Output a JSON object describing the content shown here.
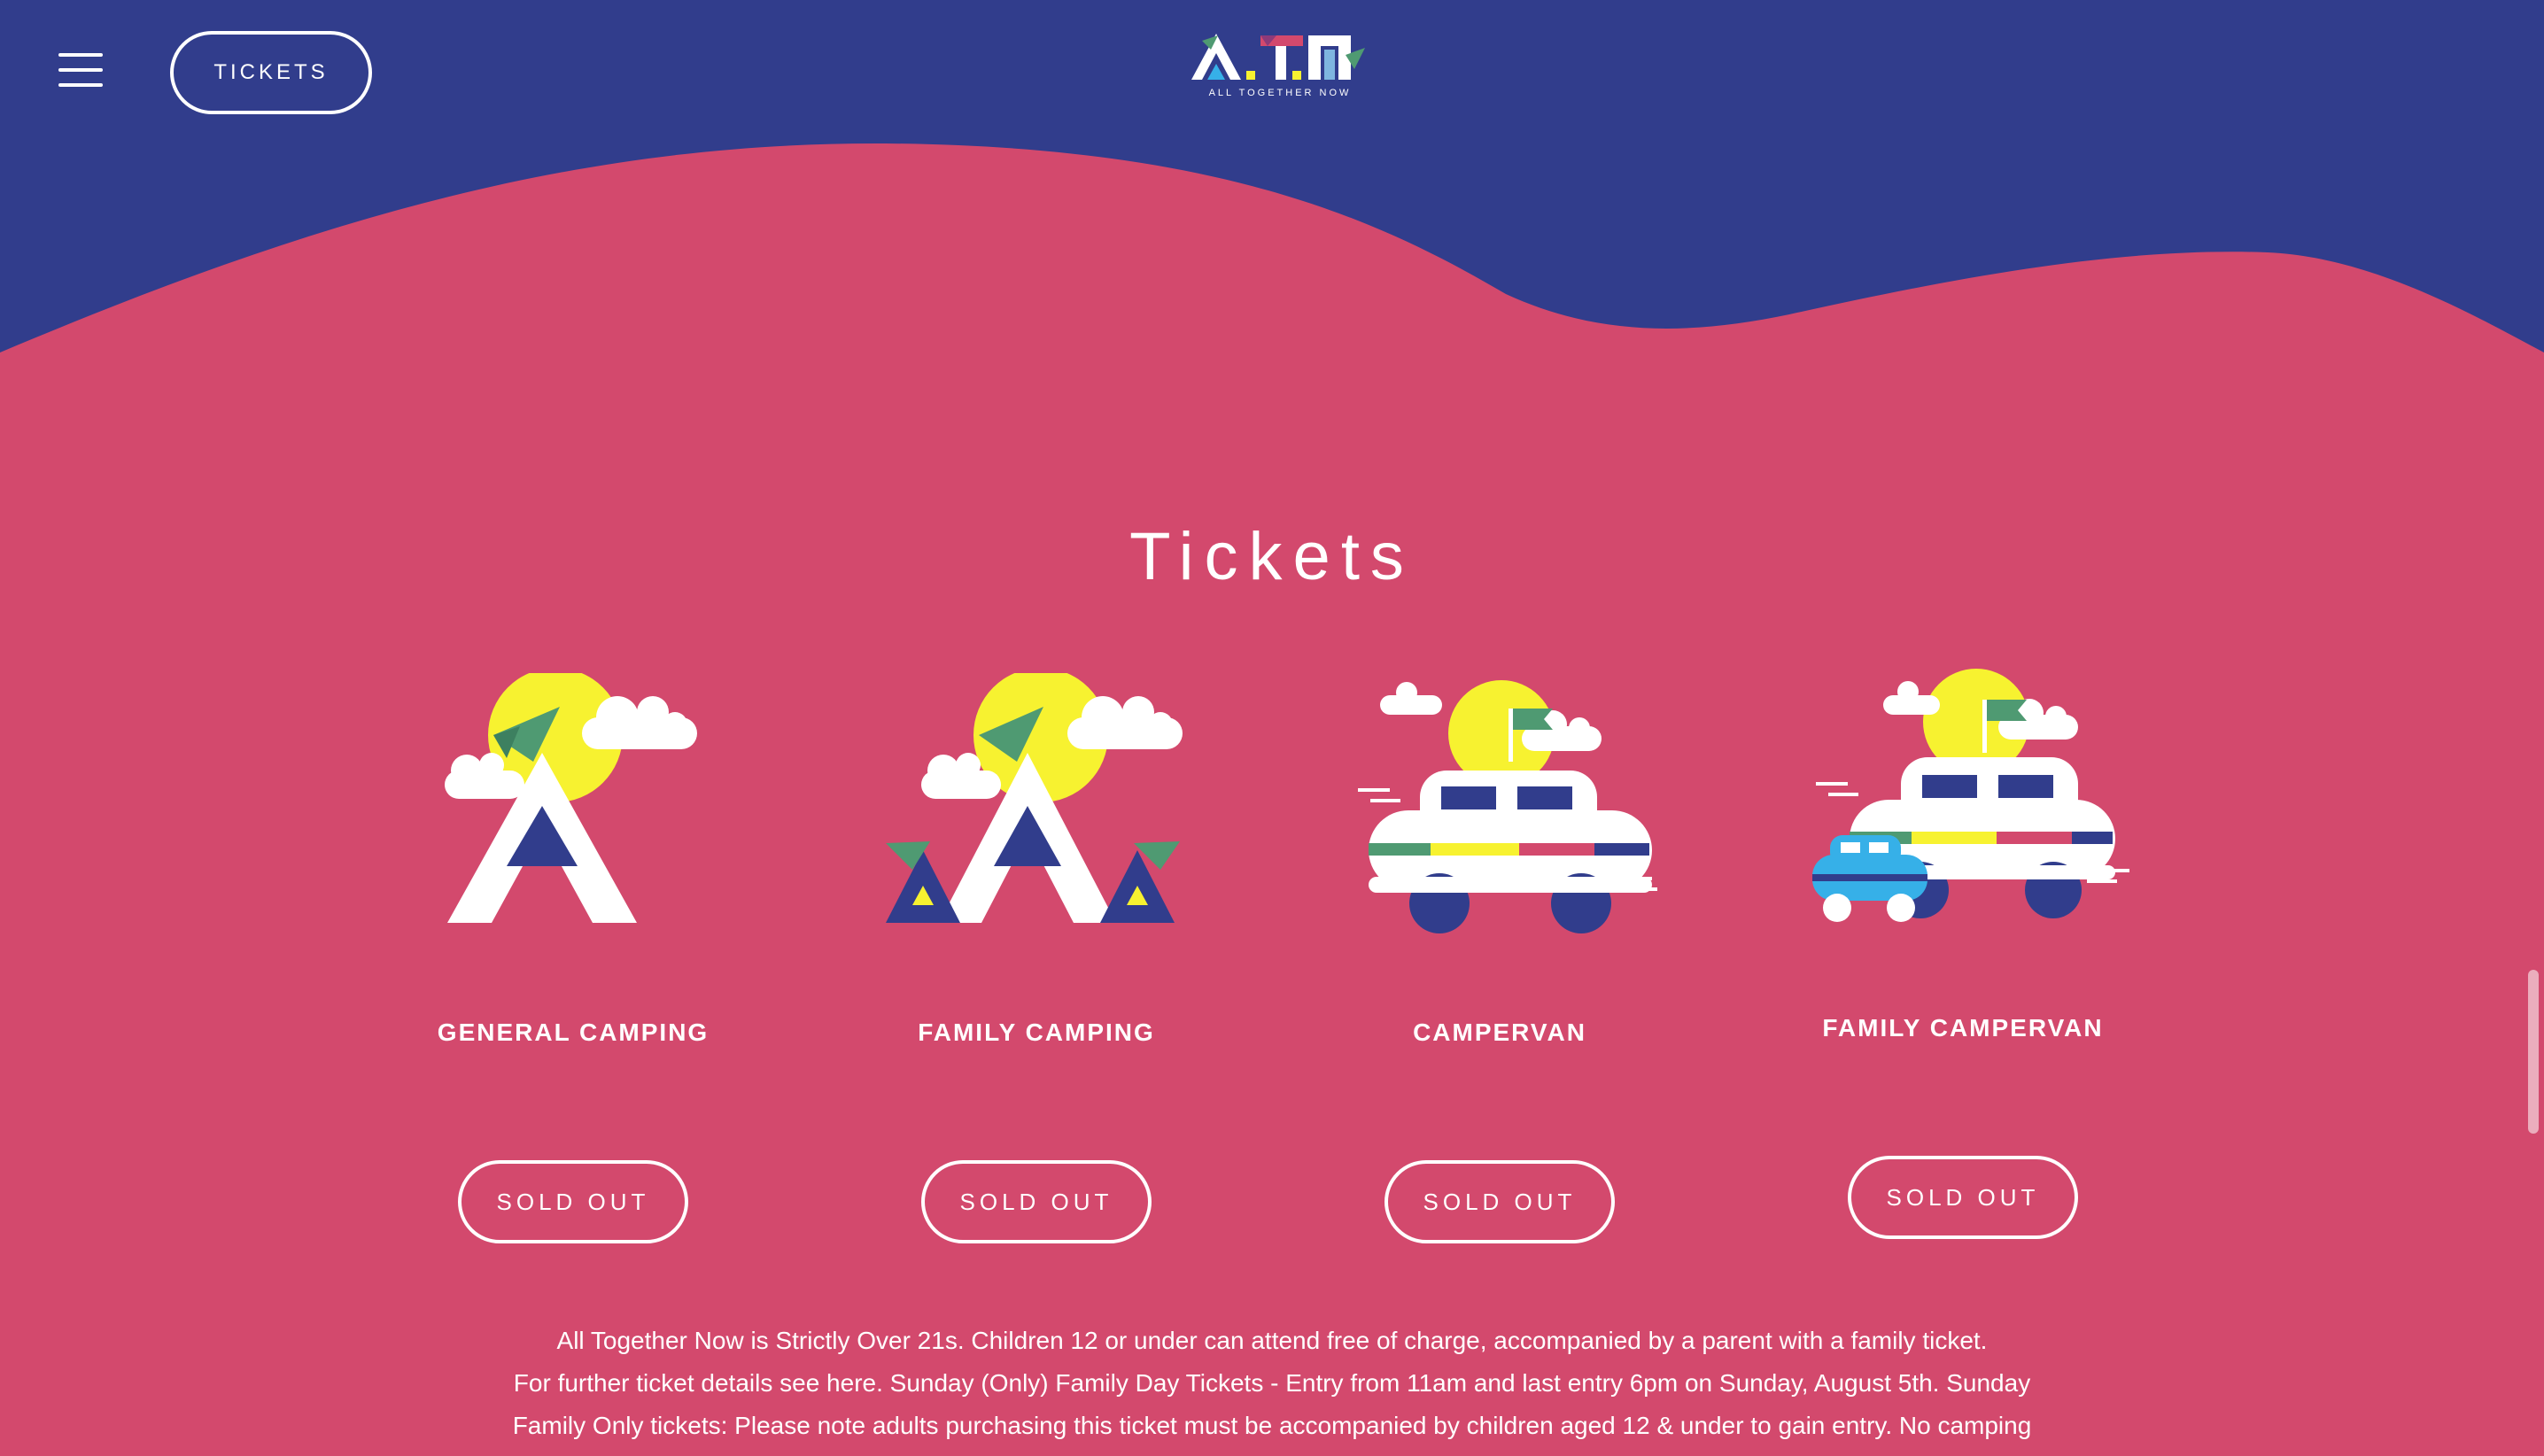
{
  "header": {
    "tickets_button_label": "TICKETS",
    "logo_text": "A.T.N",
    "logo_tagline": "ALL TOGETHER NOW",
    "menu_icon": "hamburger-menu-icon"
  },
  "colors": {
    "navy": "#313d8c",
    "pink": "#d3496d",
    "yellow": "#f7f230",
    "green": "#4f9a72",
    "white": "#ffffff",
    "light_blue": "#36b0e8"
  },
  "main": {
    "title": "Tickets",
    "tickets": [
      {
        "name": "GENERAL CAMPING",
        "button_label": "SOLD OUT",
        "icon": "tent-icon"
      },
      {
        "name": "FAMILY CAMPING",
        "button_label": "SOLD OUT",
        "icon": "family-tents-icon"
      },
      {
        "name": "CAMPERVAN",
        "button_label": "SOLD OUT",
        "icon": "campervan-icon"
      },
      {
        "name": "FAMILY CAMPERVAN",
        "button_label": "SOLD OUT",
        "icon": "campervan-with-car-icon"
      }
    ],
    "info_lines": [
      "All Together Now is Strictly Over 21s. Children 12 or under can attend free of charge, accompanied by a parent with a family ticket.",
      "For further ticket details see here. Sunday (Only) Family Day Tickets - Entry from 11am and last entry 6pm on Sunday, August 5th. Sunday",
      "Family Only tickets: Please note adults purchasing this ticket must be accompanied by children aged 12 & under to gain entry. No camping"
    ]
  }
}
